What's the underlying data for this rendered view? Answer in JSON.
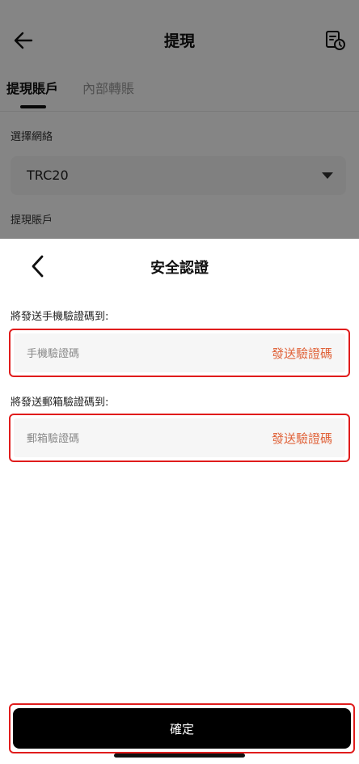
{
  "background_page": {
    "title": "提現",
    "tabs": [
      {
        "label": "提現賬戶",
        "active": true
      },
      {
        "label": "內部轉賬",
        "active": false
      }
    ],
    "network_label": "選擇網絡",
    "network_value": "TRC20",
    "account_label": "提現賬戶",
    "icons": {
      "back": "arrow-left-icon",
      "history": "record-history-icon",
      "dropdown": "caret-down-icon"
    }
  },
  "sheet": {
    "title": "安全認證",
    "phone": {
      "label": "將發送手機驗證碼到:",
      "placeholder": "手機驗證碼",
      "send_label": "發送驗證碼"
    },
    "email": {
      "label": "將發送郵箱驗證碼到:",
      "placeholder": "郵箱驗證碼",
      "send_label": "發送驗證碼"
    },
    "confirm_label": "確定"
  },
  "colors": {
    "accent": "#e0633a",
    "highlight_border": "#e01c1c",
    "button_bg": "#000000"
  }
}
